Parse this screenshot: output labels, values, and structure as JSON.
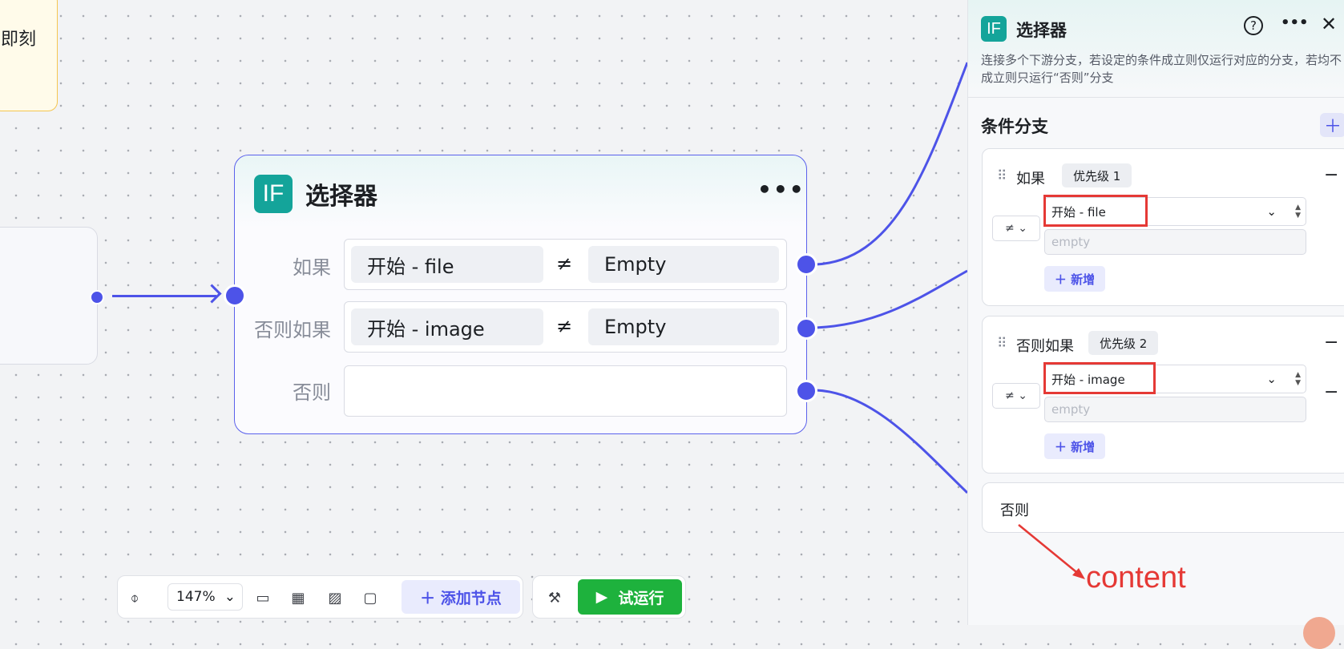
{
  "canvas": {
    "note_text": "即刻",
    "selector_node": {
      "title": "选择器",
      "icon": "IF",
      "more": "•••",
      "rows": [
        {
          "label": "如果",
          "left": "开始  -  file",
          "op": "≠",
          "right": "Empty"
        },
        {
          "label": "否则如果",
          "left": "开始  -  image",
          "op": "≠",
          "right": "Empty"
        },
        {
          "label": "否则"
        }
      ]
    }
  },
  "toolbar": {
    "zoom": "147%",
    "add_node": "添加节点",
    "run": "试运行"
  },
  "panel": {
    "icon": "IF",
    "title": "选择器",
    "description": "连接多个下游分支，若设定的条件成立则仅运行对应的分支，若均不成立则只运行“否则”分支",
    "section_title": "条件分支",
    "branches": [
      {
        "label": "如果",
        "priority": "优先级 1",
        "operator": "≠",
        "field": "开始  -  file",
        "value_placeholder": "empty",
        "add": "新增"
      },
      {
        "label": "否则如果",
        "priority": "优先级 2",
        "operator": "≠",
        "field": "开始  -  image",
        "value_placeholder": "empty",
        "add": "新增"
      }
    ],
    "else_label": "否则",
    "annotation": "content"
  },
  "colors": {
    "accent": "#4d53e8",
    "run_green": "#1eb23d",
    "annotation_red": "#e53935",
    "if_teal": "#14a49a"
  }
}
